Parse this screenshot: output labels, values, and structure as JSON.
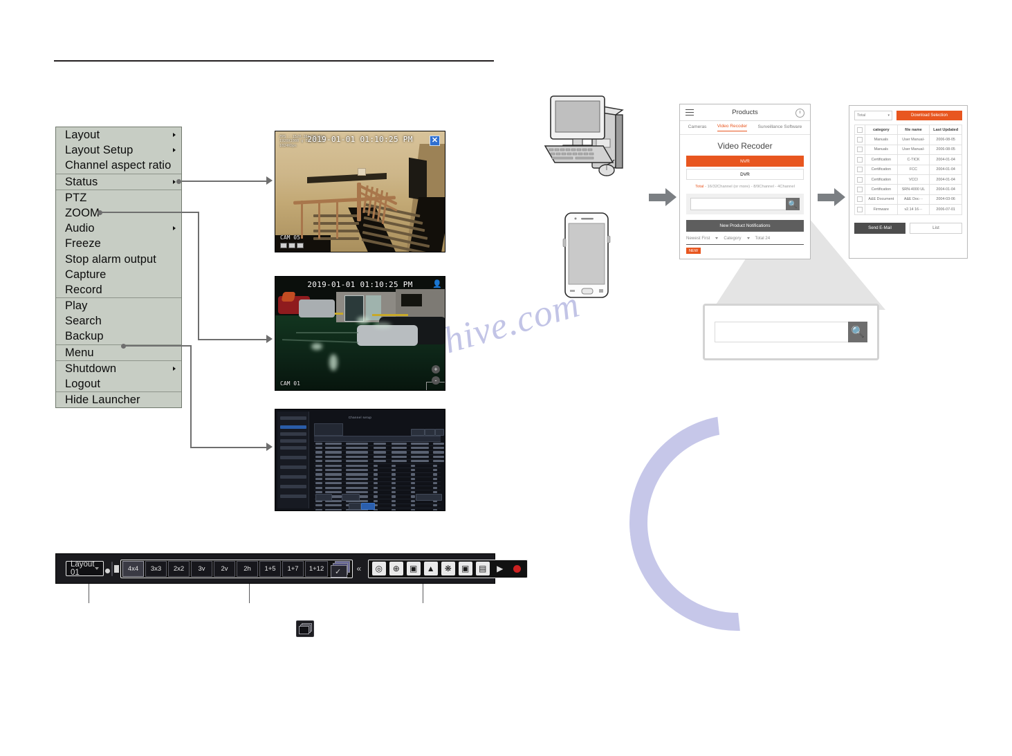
{
  "context_menu": {
    "name": "live-launcher-context-menu",
    "items": [
      {
        "label": "Layout",
        "arrow": true,
        "sep": false
      },
      {
        "label": "Layout Setup",
        "arrow": true,
        "sep": false
      },
      {
        "label": "Channel aspect ratio",
        "arrow": false,
        "sep": false
      },
      {
        "label": "Status",
        "arrow": true,
        "sep": true
      },
      {
        "label": "PTZ",
        "arrow": false,
        "sep": true
      },
      {
        "label": "ZOOM",
        "arrow": false,
        "sep": false
      },
      {
        "label": "Audio",
        "arrow": true,
        "sep": false
      },
      {
        "label": "Freeze",
        "arrow": false,
        "sep": false
      },
      {
        "label": "Stop alarm output",
        "arrow": false,
        "sep": false
      },
      {
        "label": "Capture",
        "arrow": false,
        "sep": false
      },
      {
        "label": "Record",
        "arrow": false,
        "sep": false
      },
      {
        "label": "Play",
        "arrow": false,
        "sep": true
      },
      {
        "label": "Search",
        "arrow": false,
        "sep": false
      },
      {
        "label": "Backup",
        "arrow": false,
        "sep": false
      },
      {
        "label": "Menu",
        "arrow": false,
        "sep": true
      },
      {
        "label": "Shutdown",
        "arrow": true,
        "sep": true
      },
      {
        "label": "Logout",
        "arrow": false,
        "sep": false
      },
      {
        "label": "Hide Launcher",
        "arrow": false,
        "sep": true
      }
    ]
  },
  "video_stair": {
    "timestamp": "2019-01-01 01:10:25 PM",
    "camera_label": "CAM 05",
    "osd_line1": "FPS : 15/H.264/30/fps",
    "osd_line2": "1920X1080 g 01/01/11/",
    "osd_line3": "1024Kbps",
    "audio_icon": "audio-muted-icon"
  },
  "video_parking": {
    "timestamp": "2019-01-01 01:10:25 PM",
    "camera_label": "CAM 01",
    "person_icon": "person-icon",
    "zoom_in_label": "+",
    "zoom_out_label": "-"
  },
  "video_menu_screen": {
    "title": "Channel setup",
    "camera_label": ""
  },
  "launcher": {
    "layout_select_value": "Layout 01",
    "layout_setup_icon": "layout-setup-icon",
    "split_buttons": [
      "4x4",
      "3x3",
      "2x2",
      "3v",
      "2v",
      "2h",
      "1+5",
      "1+7",
      "1+12"
    ],
    "split_active": "4x4",
    "more_layouts_icon": "layout-stack-icon",
    "collapse_icon": "«",
    "tool_icons": [
      {
        "name": "ptz-icon",
        "glyph": "◎"
      },
      {
        "name": "zoom-icon",
        "glyph": "⊕"
      },
      {
        "name": "audio-icon",
        "glyph": "▣"
      },
      {
        "name": "alarm-icon",
        "glyph": "▲"
      },
      {
        "name": "freeze-icon",
        "glyph": "❋"
      },
      {
        "name": "capture-icon",
        "glyph": "▣"
      },
      {
        "name": "display-icon",
        "glyph": "▤"
      },
      {
        "name": "play-icon",
        "glyph": "▶"
      },
      {
        "name": "record-icon",
        "glyph": "●"
      }
    ]
  },
  "standalone_icon": {
    "name": "layout-stack-icon"
  },
  "diagram": {
    "pc_icon": "desktop-computer-icon",
    "phone_icon": "mobile-phone-icon",
    "arrow_icon": "right-arrow-icon"
  },
  "web_page": {
    "menu_icon": "hamburger-menu-icon",
    "title": "Products",
    "clock_icon": "history-clock-icon",
    "tabs": [
      {
        "label": "Cameras",
        "active": false
      },
      {
        "label": "Video Recoder",
        "active": true
      },
      {
        "label": "Surveillance Software",
        "active": false
      }
    ],
    "heading": "Video Recoder",
    "options": [
      {
        "label": "NVR",
        "selected": true
      },
      {
        "label": "DVR",
        "selected": false
      }
    ],
    "filter_total": "Total",
    "filter_rest": "- 16/32Channel (or more)  - 8/9Channel  - 4Channel",
    "search_placeholder": "",
    "search_value": "",
    "search_icon": "search-icon",
    "notification_label": "New Product Notifications",
    "sorts": [
      "Newest First",
      "Category",
      "Total 24"
    ],
    "new_badge": "NEW"
  },
  "download_table": {
    "filter_value": "Total",
    "download_button": "Download Selection",
    "columns": [
      "",
      "category",
      "file name",
      "Last Updated"
    ],
    "rows": [
      {
        "category": "Manuals",
        "file_name": "User Manual-",
        "last_updated": "2006-08-05"
      },
      {
        "category": "Manuals",
        "file_name": "User Manual-",
        "last_updated": "2006-08-05"
      },
      {
        "category": "Certification",
        "file_name": "C-TICK",
        "last_updated": "2004-01-04"
      },
      {
        "category": "Certification",
        "file_name": "FCC",
        "last_updated": "2004-01-04"
      },
      {
        "category": "Certification",
        "file_name": "VCCI",
        "last_updated": "2004-01-04"
      },
      {
        "category": "Certification",
        "file_name": "SRN-4000 UL",
        "last_updated": "2004-01-04"
      },
      {
        "category": "A&E Document",
        "file_name": "A&E Doc···",
        "last_updated": "2004-03-06"
      },
      {
        "category": "Firmware",
        "file_name": "v2.14  16···",
        "last_updated": "2006-07-01"
      }
    ],
    "send_email_button": "Send E-Mail",
    "list_button": "List"
  },
  "callout": {
    "search_value": "",
    "search_icon": "search-icon"
  },
  "watermark": {
    "text": "manualshive.com"
  },
  "colors": {
    "accent_orange": "#e8561f",
    "menu_bg": "#c7cdc4",
    "launcher_bg": "#1b1b1f",
    "arrow_gray": "#7b7f83"
  }
}
